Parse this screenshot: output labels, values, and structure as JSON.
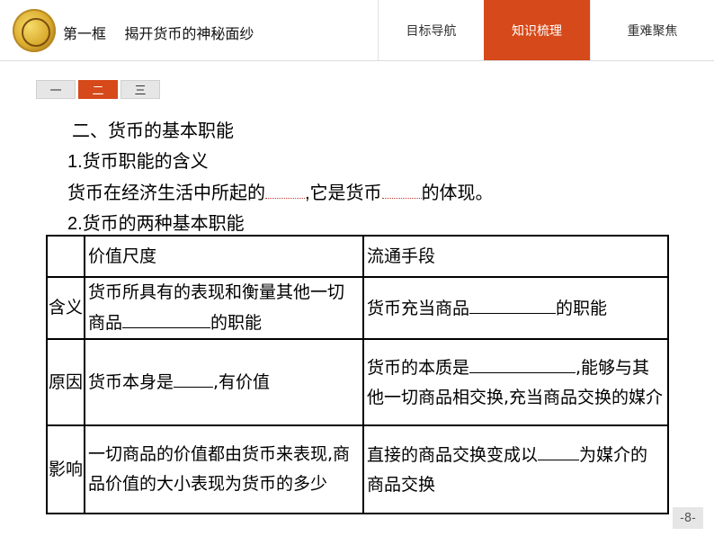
{
  "header": {
    "title": "第一框    揭开货币的神秘面纱",
    "tabs": [
      {
        "label": "目标导航",
        "active": false
      },
      {
        "label": "知识梳理",
        "active": true
      },
      {
        "label": "重难聚焦",
        "active": false
      }
    ]
  },
  "subtabs": [
    {
      "label": "一",
      "active": false
    },
    {
      "label": "二",
      "active": true
    },
    {
      "label": "三",
      "active": false
    }
  ],
  "content": {
    "heading": "二、货币的基本职能",
    "sub1": "1.货币职能的含义",
    "line1_a": "货币在经济生活中所起的",
    "line1_b": ",它是货币",
    "line1_c": "的体现。",
    "sub2": "2.货币的两种基本职能"
  },
  "table": {
    "col1": "价值尺度",
    "col2": "流通手段",
    "rows": [
      {
        "head": "含义",
        "c1_a": "货币所具有的表现和衡量其他一切商品",
        "c1_b": "的职能",
        "c2_a": "货币充当商品",
        "c2_b": "的职能"
      },
      {
        "head": "原因",
        "c1_a": "货币本身是",
        "c1_b": ",有价值",
        "c2_a": "货币的本质是",
        "c2_b": ",能够与其他一切商品相交换,充当商品交换的媒介"
      },
      {
        "head": "影响",
        "c1_a": "一切商品的价值都由货币来表现,商品价值的大小表现为货币的多少",
        "c2_a": "直接的商品交换变成以",
        "c2_b": "为媒介的商品交换"
      }
    ]
  },
  "page_number": "-8-",
  "colors": {
    "accent": "#d6491a",
    "blank_mark": "#c0392b"
  }
}
